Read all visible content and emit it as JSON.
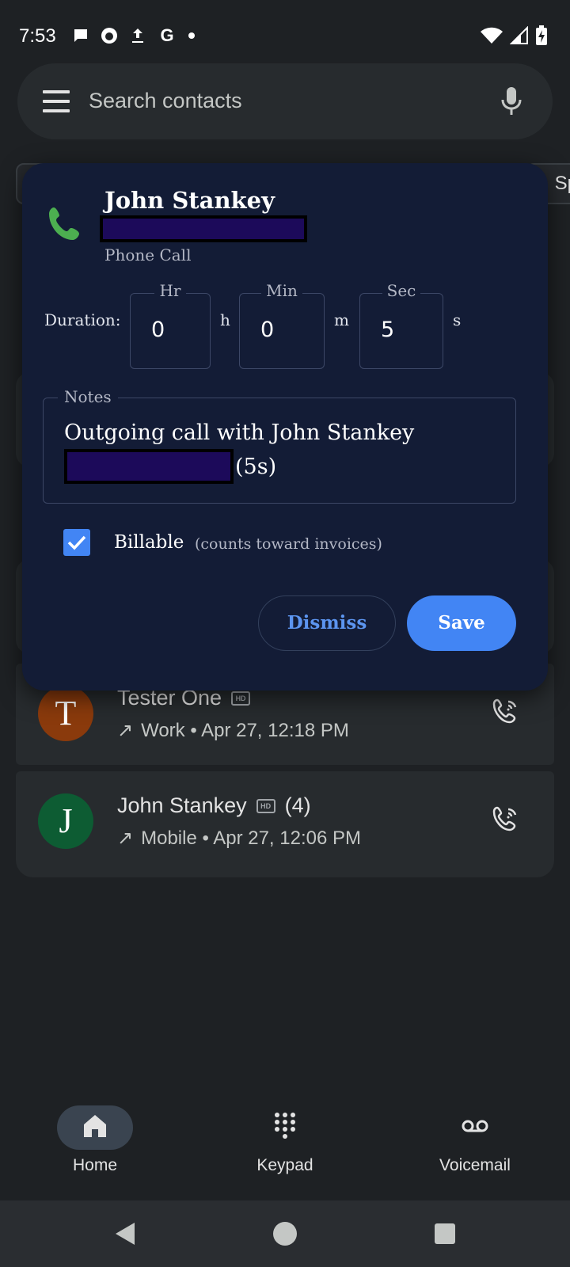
{
  "status_bar": {
    "time": "7:53",
    "icons_left": [
      "chat-bubble-icon",
      "github-icon",
      "upload-icon",
      "google-icon",
      "dot-icon"
    ],
    "icons_right": [
      "wifi-icon",
      "signal-icon",
      "battery-charging-icon"
    ],
    "google_glyph": "G"
  },
  "search": {
    "placeholder": "Search contacts"
  },
  "chips": {
    "partial_text": "Sp"
  },
  "call_log": [
    {
      "avatar_letter": "T",
      "avatar_color": "#8a3a0c",
      "name": "Tester One",
      "count": "",
      "direction": "↗",
      "meta": "Work • Apr 27, 12:18 PM"
    },
    {
      "avatar_letter": "J",
      "avatar_color": "#0d5c33",
      "name": "John Stankey",
      "count": "(4)",
      "direction": "↗",
      "meta": "Mobile • Apr 27, 12:06 PM"
    }
  ],
  "dialog": {
    "title": "John Stankey",
    "subtitle": "Phone Call",
    "duration_label": "Duration:",
    "fields": [
      {
        "label": "Hr",
        "value": "0",
        "unit": "h"
      },
      {
        "label": "Min",
        "value": "0",
        "unit": "m"
      },
      {
        "label": "Sec",
        "value": "5",
        "unit": "s"
      }
    ],
    "notes_label": "Notes",
    "notes_line1": "Outgoing call with John Stankey",
    "notes_line2_suffix": "(5s)",
    "billable_label": "Billable",
    "billable_hint": "(counts toward invoices)",
    "billable_checked": true,
    "dismiss_label": "Dismiss",
    "save_label": "Save"
  },
  "bottom_nav": {
    "items": [
      {
        "label": "Home",
        "icon": "home-icon",
        "active": true
      },
      {
        "label": "Keypad",
        "icon": "keypad-icon",
        "active": false
      },
      {
        "label": "Voicemail",
        "icon": "voicemail-icon",
        "active": false
      }
    ]
  },
  "colors": {
    "accent": "#4285f4",
    "dialog_bg": "#131c36",
    "phone_green": "#4caf50"
  }
}
